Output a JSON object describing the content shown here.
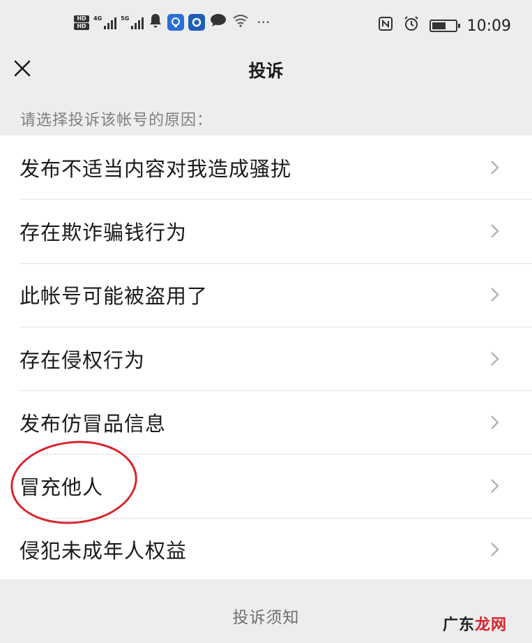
{
  "status_bar": {
    "hd_labels": [
      "HD",
      "HD"
    ],
    "signal_labels": [
      "4G",
      "5G"
    ],
    "icons": [
      "hd-icon",
      "signal-icon",
      "bell-icon",
      "app-icon",
      "app-icon",
      "chat-icon",
      "wifi-icon",
      "more-icon",
      "nfc-icon",
      "alarm-icon",
      "battery-icon"
    ],
    "more_text": "···",
    "time": "10:09"
  },
  "nav": {
    "close_icon": "close-icon",
    "title": "投诉"
  },
  "prompt": "请选择投诉该帐号的原因：",
  "reasons": [
    {
      "label": "发布不适当内容对我造成骚扰"
    },
    {
      "label": "存在欺诈骗钱行为"
    },
    {
      "label": "此帐号可能被盗用了"
    },
    {
      "label": "存在侵权行为"
    },
    {
      "label": "发布仿冒品信息"
    },
    {
      "label": "冒充他人",
      "highlighted": true
    },
    {
      "label": "侵犯未成年人权益"
    }
  ],
  "footer": {
    "link": "投诉须知"
  },
  "watermark": {
    "prefix": "广东",
    "suffix": "龙网"
  },
  "colors": {
    "background": "#ededed",
    "list_background": "#ffffff",
    "highlight": "#d9242b",
    "prompt_text": "#7f7f7f"
  }
}
